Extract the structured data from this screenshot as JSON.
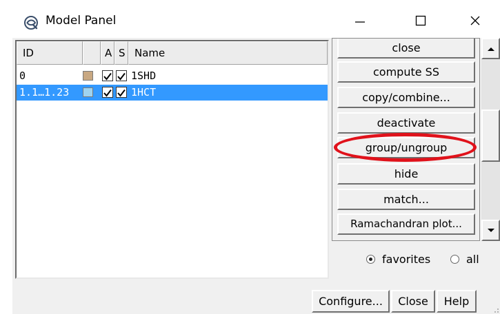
{
  "window": {
    "title": "Model Panel",
    "minimize_symbol": "—",
    "maximize_symbol": "☐",
    "close_symbol": "✕"
  },
  "table": {
    "headers": [
      "ID",
      "",
      "A",
      "S",
      "Name"
    ],
    "rows": [
      {
        "id": "0",
        "color": "#c8a882",
        "active": true,
        "shown": true,
        "name": "1SHD",
        "selected": false
      },
      {
        "id": "1.1…1.23",
        "color": "#9fd3ef",
        "active": true,
        "shown": true,
        "name": "1HCT",
        "selected": true
      }
    ]
  },
  "commands": {
    "buttons": [
      "close",
      "compute SS",
      "copy/combine...",
      "deactivate",
      "group/ungroup",
      "hide",
      "match...",
      "Ramachandran plot..."
    ]
  },
  "filter": {
    "options": [
      "favorites",
      "all"
    ],
    "selected": "favorites"
  },
  "footer": {
    "configure_label": "Configure...",
    "close_label": "Close",
    "help_label": "Help"
  },
  "annotation": {
    "highlight_color": "#e0121b",
    "target": "group/ungroup"
  },
  "icons": {
    "app": "chimera-icon",
    "scroll_up": "arrow-up-icon",
    "scroll_down": "arrow-down-icon",
    "resize": "resize-grip-icon"
  }
}
